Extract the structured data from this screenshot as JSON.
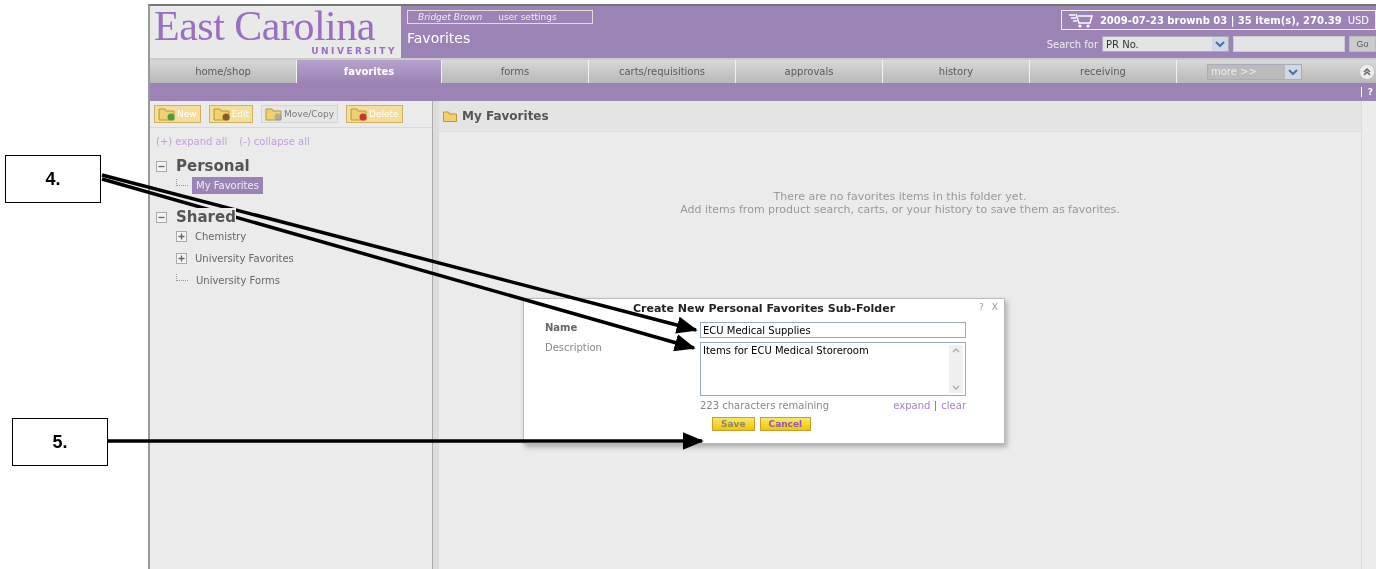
{
  "header": {
    "logo": "East Carolina",
    "logo_sub": "UNIVERSITY",
    "user": "Bridget Brown",
    "settings": "user settings",
    "page_title": "Favorites",
    "cart": "2009-07-23 brownb 03 | 35 item(s), 270.39",
    "currency": "USD",
    "search_label": "Search for",
    "search_type": "PR No.",
    "go": "Go"
  },
  "tabs": [
    {
      "label": "home/shop",
      "selected": false
    },
    {
      "label": "favorites",
      "selected": true
    },
    {
      "label": "forms",
      "selected": false
    },
    {
      "label": "carts/requisitions",
      "selected": false
    },
    {
      "label": "approvals",
      "selected": false
    },
    {
      "label": "history",
      "selected": false
    },
    {
      "label": "receiving",
      "selected": false
    }
  ],
  "more": "more >>",
  "help": "?",
  "toolbar": [
    {
      "label": "New",
      "kind": "new",
      "disabled": false
    },
    {
      "label": "Edit",
      "kind": "edit",
      "disabled": false
    },
    {
      "label": "Move/Copy",
      "kind": "move",
      "disabled": true
    },
    {
      "label": "Delete",
      "kind": "delete",
      "disabled": false
    }
  ],
  "expand_all": "(+) expand all",
  "collapse_all": "(-) collapse all",
  "tree": [
    {
      "label": "Personal",
      "expanded": true,
      "children": [
        {
          "label": "My Favorites",
          "selected": true,
          "expandable": false
        }
      ]
    },
    {
      "label": "Shared",
      "expanded": true,
      "children": [
        {
          "label": "Chemistry",
          "selected": false,
          "expandable": true
        },
        {
          "label": "University Favorites",
          "selected": false,
          "expandable": true
        },
        {
          "label": "University Forms",
          "selected": false,
          "expandable": false
        }
      ]
    }
  ],
  "content": {
    "title": "My Favorites",
    "empty": [
      "There are no favorites items in this folder yet.",
      "Add items from product search, carts, or your history to save them as favorites."
    ]
  },
  "dialog": {
    "title": "Create New Personal Favorites Sub-Folder",
    "help": "?",
    "close": "X",
    "name_label": "Name",
    "name": "ECU Medical Supplies",
    "description_label": "Description",
    "description": "Items for ECU Medical Storeroom",
    "remaining": "223 characters remaining",
    "expand": "expand",
    "clear": "clear",
    "save": "Save",
    "cancel": "Cancel"
  },
  "callouts": [
    "4.",
    "5."
  ]
}
